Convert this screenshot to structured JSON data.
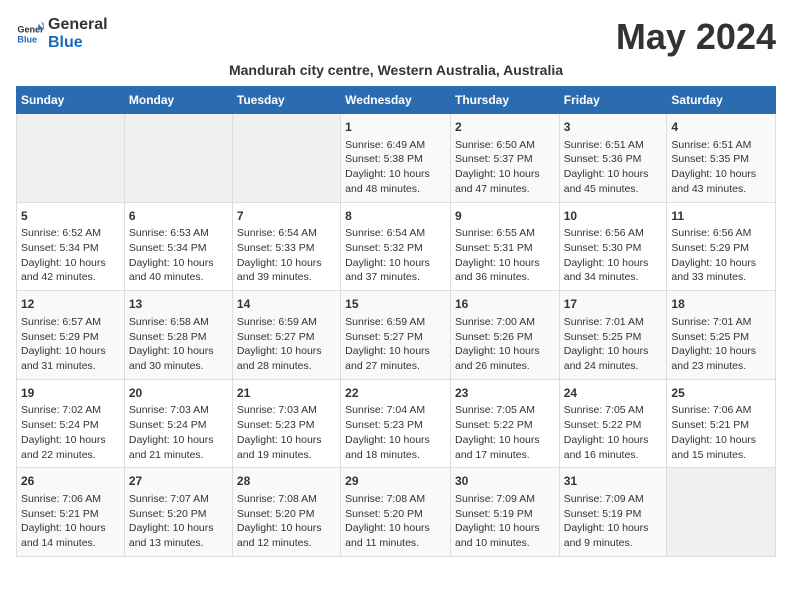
{
  "header": {
    "logo_general": "General",
    "logo_blue": "Blue",
    "month_title": "May 2024",
    "subtitle": "Mandurah city centre, Western Australia, Australia"
  },
  "calendar": {
    "days_of_week": [
      "Sunday",
      "Monday",
      "Tuesday",
      "Wednesday",
      "Thursday",
      "Friday",
      "Saturday"
    ],
    "weeks": [
      [
        {
          "day": "",
          "empty": true
        },
        {
          "day": "",
          "empty": true
        },
        {
          "day": "",
          "empty": true
        },
        {
          "day": "1",
          "sunrise": "6:49 AM",
          "sunset": "5:38 PM",
          "daylight": "10 hours and 48 minutes."
        },
        {
          "day": "2",
          "sunrise": "6:50 AM",
          "sunset": "5:37 PM",
          "daylight": "10 hours and 47 minutes."
        },
        {
          "day": "3",
          "sunrise": "6:51 AM",
          "sunset": "5:36 PM",
          "daylight": "10 hours and 45 minutes."
        },
        {
          "day": "4",
          "sunrise": "6:51 AM",
          "sunset": "5:35 PM",
          "daylight": "10 hours and 43 minutes."
        }
      ],
      [
        {
          "day": "5",
          "sunrise": "6:52 AM",
          "sunset": "5:34 PM",
          "daylight": "10 hours and 42 minutes."
        },
        {
          "day": "6",
          "sunrise": "6:53 AM",
          "sunset": "5:34 PM",
          "daylight": "10 hours and 40 minutes."
        },
        {
          "day": "7",
          "sunrise": "6:54 AM",
          "sunset": "5:33 PM",
          "daylight": "10 hours and 39 minutes."
        },
        {
          "day": "8",
          "sunrise": "6:54 AM",
          "sunset": "5:32 PM",
          "daylight": "10 hours and 37 minutes."
        },
        {
          "day": "9",
          "sunrise": "6:55 AM",
          "sunset": "5:31 PM",
          "daylight": "10 hours and 36 minutes."
        },
        {
          "day": "10",
          "sunrise": "6:56 AM",
          "sunset": "5:30 PM",
          "daylight": "10 hours and 34 minutes."
        },
        {
          "day": "11",
          "sunrise": "6:56 AM",
          "sunset": "5:29 PM",
          "daylight": "10 hours and 33 minutes."
        }
      ],
      [
        {
          "day": "12",
          "sunrise": "6:57 AM",
          "sunset": "5:29 PM",
          "daylight": "10 hours and 31 minutes."
        },
        {
          "day": "13",
          "sunrise": "6:58 AM",
          "sunset": "5:28 PM",
          "daylight": "10 hours and 30 minutes."
        },
        {
          "day": "14",
          "sunrise": "6:59 AM",
          "sunset": "5:27 PM",
          "daylight": "10 hours and 28 minutes."
        },
        {
          "day": "15",
          "sunrise": "6:59 AM",
          "sunset": "5:27 PM",
          "daylight": "10 hours and 27 minutes."
        },
        {
          "day": "16",
          "sunrise": "7:00 AM",
          "sunset": "5:26 PM",
          "daylight": "10 hours and 26 minutes."
        },
        {
          "day": "17",
          "sunrise": "7:01 AM",
          "sunset": "5:25 PM",
          "daylight": "10 hours and 24 minutes."
        },
        {
          "day": "18",
          "sunrise": "7:01 AM",
          "sunset": "5:25 PM",
          "daylight": "10 hours and 23 minutes."
        }
      ],
      [
        {
          "day": "19",
          "sunrise": "7:02 AM",
          "sunset": "5:24 PM",
          "daylight": "10 hours and 22 minutes."
        },
        {
          "day": "20",
          "sunrise": "7:03 AM",
          "sunset": "5:24 PM",
          "daylight": "10 hours and 21 minutes."
        },
        {
          "day": "21",
          "sunrise": "7:03 AM",
          "sunset": "5:23 PM",
          "daylight": "10 hours and 19 minutes."
        },
        {
          "day": "22",
          "sunrise": "7:04 AM",
          "sunset": "5:23 PM",
          "daylight": "10 hours and 18 minutes."
        },
        {
          "day": "23",
          "sunrise": "7:05 AM",
          "sunset": "5:22 PM",
          "daylight": "10 hours and 17 minutes."
        },
        {
          "day": "24",
          "sunrise": "7:05 AM",
          "sunset": "5:22 PM",
          "daylight": "10 hours and 16 minutes."
        },
        {
          "day": "25",
          "sunrise": "7:06 AM",
          "sunset": "5:21 PM",
          "daylight": "10 hours and 15 minutes."
        }
      ],
      [
        {
          "day": "26",
          "sunrise": "7:06 AM",
          "sunset": "5:21 PM",
          "daylight": "10 hours and 14 minutes."
        },
        {
          "day": "27",
          "sunrise": "7:07 AM",
          "sunset": "5:20 PM",
          "daylight": "10 hours and 13 minutes."
        },
        {
          "day": "28",
          "sunrise": "7:08 AM",
          "sunset": "5:20 PM",
          "daylight": "10 hours and 12 minutes."
        },
        {
          "day": "29",
          "sunrise": "7:08 AM",
          "sunset": "5:20 PM",
          "daylight": "10 hours and 11 minutes."
        },
        {
          "day": "30",
          "sunrise": "7:09 AM",
          "sunset": "5:19 PM",
          "daylight": "10 hours and 10 minutes."
        },
        {
          "day": "31",
          "sunrise": "7:09 AM",
          "sunset": "5:19 PM",
          "daylight": "10 hours and 9 minutes."
        },
        {
          "day": "",
          "empty": true
        }
      ]
    ]
  }
}
